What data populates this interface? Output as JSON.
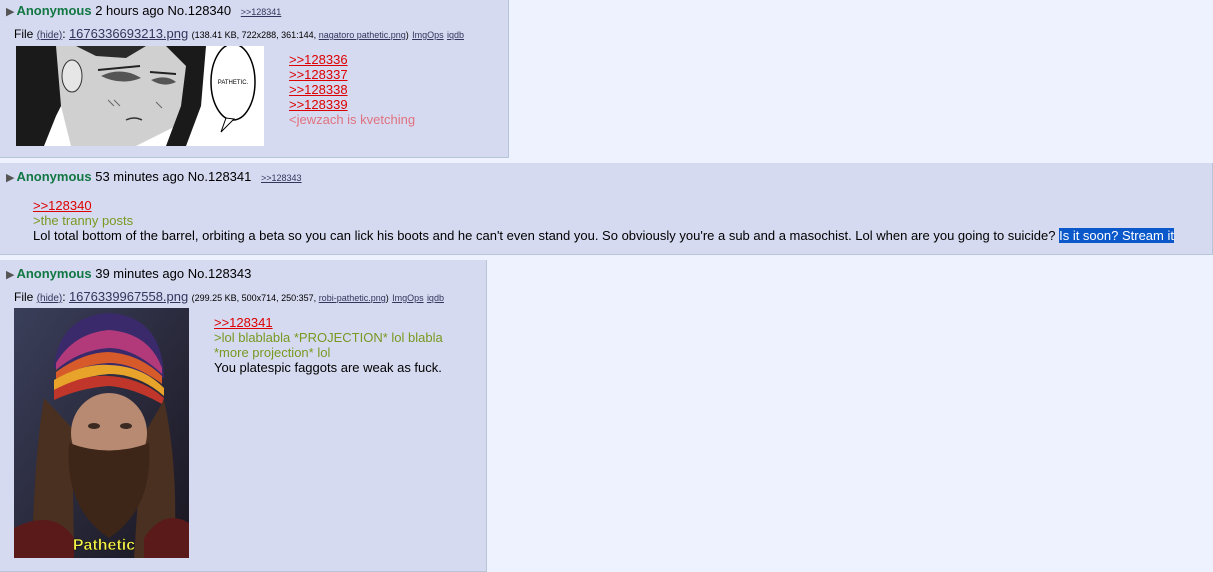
{
  "posts": [
    {
      "name": "Anonymous",
      "time": "2 hours ago",
      "no": "No.128340",
      "backlinks": [
        ">>128341"
      ],
      "file": {
        "label": "File",
        "hide": "(hide)",
        "filename": "1676336693213.png",
        "meta_prefix": "(138.41 KB, 722x288, 361:144, ",
        "orig_name": "nagatoro pathetic.png",
        "meta_suffix": ")",
        "tool1": "ImgOps",
        "tool2": "iqdb"
      },
      "thumb_text": "PATHETIC.",
      "quotes": [
        ">>128336",
        ">>128337",
        ">>128338",
        ">>128339"
      ],
      "lines": [
        "<jewzach is kvetching"
      ]
    },
    {
      "name": "Anonymous",
      "time": "53 minutes ago",
      "no": "No.128341",
      "backlinks": [
        ">>128343"
      ],
      "quotes": [
        ">>128340"
      ],
      "greentext": [
        ">the tranny posts"
      ],
      "text": "Lol total bottom of the barrel, orbiting a beta so you can lick his boots and he can't even stand you. So obviously you're a sub and a masochist. Lol when are you going to suicide? ",
      "selected_text": "Is it soon? Stream it"
    },
    {
      "name": "Anonymous",
      "time": "39 minutes ago",
      "no": "No.128343",
      "file": {
        "label": "File",
        "hide": "(hide)",
        "filename": "1676339967558.png",
        "meta_prefix": "(299.25 KB, 500x714, 250:357, ",
        "orig_name": "robi-pathetic.png",
        "meta_suffix": ")",
        "tool1": "ImgOps",
        "tool2": "iqdb"
      },
      "thumb_caption": "Pathetic",
      "quotes": [
        ">>128341"
      ],
      "greentext": [
        ">lol blablabla *PROJECTION* lol blabla",
        "*more projection* lol"
      ],
      "text": "You platespic faggots are weak as fuck."
    }
  ],
  "colors": {
    "page_bg": "#eef2ff",
    "post_bg": "#d6daf0",
    "name": "#117743",
    "quotelink": "#dd0000",
    "greentext": "#789922",
    "pinktext": "#e0727f",
    "selection": "#0a58ca"
  }
}
